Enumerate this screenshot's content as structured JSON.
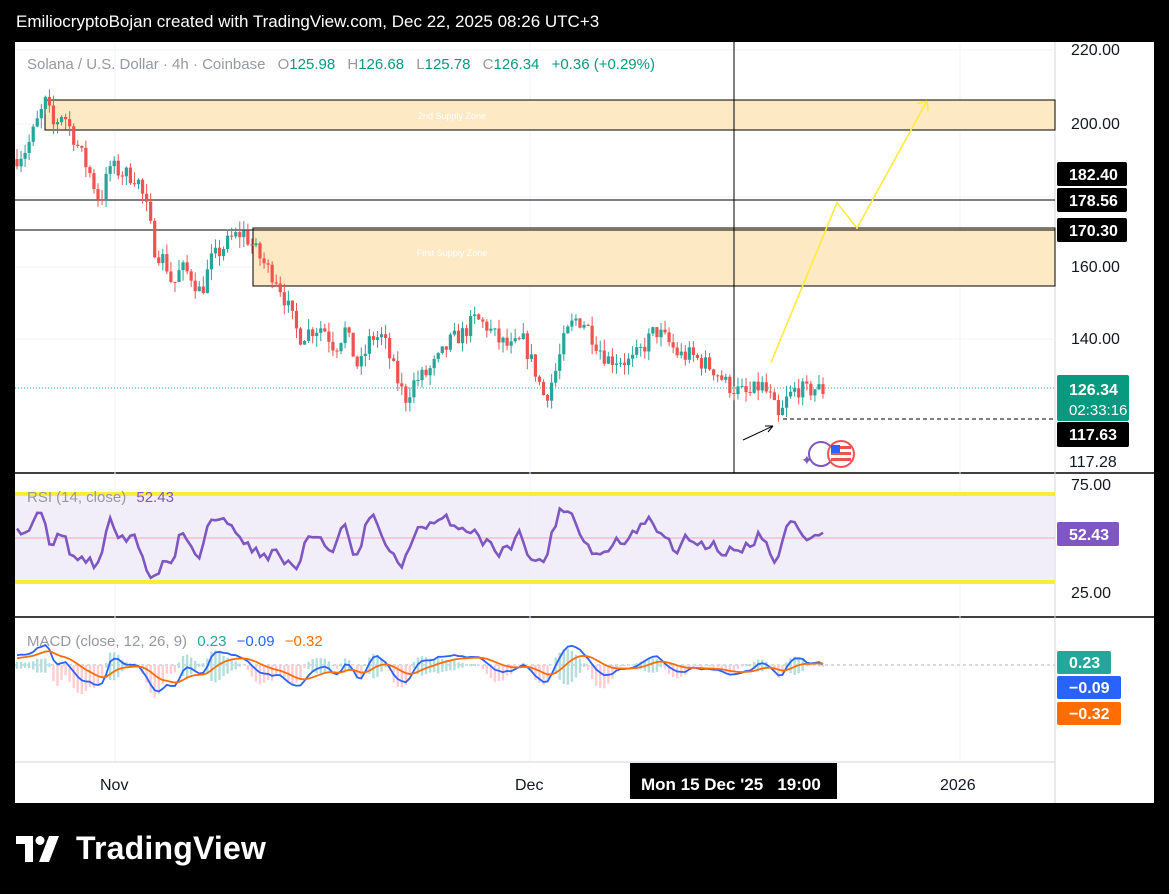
{
  "header": {
    "caption": "EmiliocryptoBojan created with TradingView.com, Dec 22, 2025 08:26 UTC+3"
  },
  "footer": {
    "brand": "TradingView"
  },
  "legend": {
    "symbol": "Solana / U.S. Dollar · 4h · Coinbase",
    "o_label": "O",
    "o_value": "125.98",
    "h_label": "H",
    "h_value": "126.68",
    "l_label": "L",
    "l_value": "125.78",
    "c_label": "C",
    "c_value": "126.34",
    "change": "+0.36 (+0.29%)"
  },
  "zones": {
    "zone2": "2nd Supply Zone",
    "zone1": "First Supply Zone"
  },
  "price_axis": {
    "ticks": [
      "220.00",
      "200.00",
      "160.00",
      "140.00"
    ],
    "labels": {
      "l182": "182.40",
      "l178": "178.56",
      "l170": "170.30",
      "current": "126.34",
      "countdown": "02:33:16",
      "l117a": "117.63",
      "l117b": "117.28"
    }
  },
  "rsi": {
    "title": "RSI (14, close)",
    "value": "52.43",
    "ticks": [
      "75.00",
      "25.00"
    ],
    "badge": "52.43"
  },
  "macd": {
    "title": "MACD (close, 12, 26, 9)",
    "v1": "0.23",
    "v2": "−0.09",
    "v3": "−0.32",
    "badges": [
      "0.23",
      "−0.09",
      "−0.32"
    ]
  },
  "time_axis": {
    "labels": [
      "Nov",
      "Dec",
      "2026"
    ],
    "crosshair": "Mon 15 Dec '25   19:00"
  },
  "colors": {
    "up": "#26a69a",
    "down": "#ef5350",
    "rsi": "#7e57c2",
    "macd": "#2962ff",
    "signal": "#ff6d00",
    "zone": "#fde9c4",
    "projection": "#ffeb3b"
  },
  "chart_data": {
    "type": "candlestick",
    "title": "Solana / U.S. Dollar · 4h · Coinbase",
    "ylim": [
      110,
      222
    ],
    "x": [
      "Nov",
      "Dec",
      "2026"
    ],
    "supply_zones": [
      {
        "name": "2nd Supply Zone",
        "from": 198,
        "to": 206
      },
      {
        "name": "First Supply Zone",
        "from": 154.5,
        "to": 170.5
      }
    ],
    "levels": [
      182.4,
      178.56,
      170.3,
      126.34,
      117.63,
      117.28
    ],
    "close_path": [
      {
        "x": 0,
        "y": 190
      },
      {
        "x": 12,
        "y": 193
      },
      {
        "x": 22,
        "y": 200
      },
      {
        "x": 31,
        "y": 206
      },
      {
        "x": 38,
        "y": 199
      },
      {
        "x": 48,
        "y": 203
      },
      {
        "x": 62,
        "y": 194
      },
      {
        "x": 75,
        "y": 186
      },
      {
        "x": 85,
        "y": 178
      },
      {
        "x": 95,
        "y": 188
      },
      {
        "x": 108,
        "y": 186
      },
      {
        "x": 122,
        "y": 185
      },
      {
        "x": 132,
        "y": 176
      },
      {
        "x": 140,
        "y": 165
      },
      {
        "x": 150,
        "y": 162
      },
      {
        "x": 158,
        "y": 155
      },
      {
        "x": 166,
        "y": 160
      },
      {
        "x": 176,
        "y": 158
      },
      {
        "x": 186,
        "y": 153
      },
      {
        "x": 196,
        "y": 162
      },
      {
        "x": 206,
        "y": 165
      },
      {
        "x": 216,
        "y": 168
      },
      {
        "x": 228,
        "y": 170
      },
      {
        "x": 240,
        "y": 165
      },
      {
        "x": 252,
        "y": 160
      },
      {
        "x": 262,
        "y": 157
      },
      {
        "x": 272,
        "y": 150
      },
      {
        "x": 284,
        "y": 141
      },
      {
        "x": 296,
        "y": 143
      },
      {
        "x": 308,
        "y": 144
      },
      {
        "x": 320,
        "y": 138
      },
      {
        "x": 330,
        "y": 143
      },
      {
        "x": 344,
        "y": 132
      },
      {
        "x": 356,
        "y": 141
      },
      {
        "x": 368,
        "y": 141
      },
      {
        "x": 380,
        "y": 131
      },
      {
        "x": 390,
        "y": 124
      },
      {
        "x": 400,
        "y": 129
      },
      {
        "x": 412,
        "y": 131
      },
      {
        "x": 424,
        "y": 135
      },
      {
        "x": 436,
        "y": 140
      },
      {
        "x": 448,
        "y": 142
      },
      {
        "x": 460,
        "y": 146
      },
      {
        "x": 472,
        "y": 144
      },
      {
        "x": 484,
        "y": 140
      },
      {
        "x": 496,
        "y": 138
      },
      {
        "x": 508,
        "y": 140
      },
      {
        "x": 520,
        "y": 132
      },
      {
        "x": 530,
        "y": 124
      },
      {
        "x": 540,
        "y": 131
      },
      {
        "x": 550,
        "y": 141
      },
      {
        "x": 560,
        "y": 146
      },
      {
        "x": 570,
        "y": 145
      },
      {
        "x": 580,
        "y": 140
      },
      {
        "x": 592,
        "y": 135
      },
      {
        "x": 604,
        "y": 135
      },
      {
        "x": 616,
        "y": 134
      },
      {
        "x": 628,
        "y": 138
      },
      {
        "x": 640,
        "y": 143
      },
      {
        "x": 652,
        "y": 140
      },
      {
        "x": 664,
        "y": 136
      },
      {
        "x": 676,
        "y": 136
      },
      {
        "x": 688,
        "y": 134
      },
      {
        "x": 700,
        "y": 132
      },
      {
        "x": 712,
        "y": 128
      },
      {
        "x": 724,
        "y": 126
      },
      {
        "x": 734,
        "y": 125
      },
      {
        "x": 746,
        "y": 128
      },
      {
        "x": 756,
        "y": 124
      },
      {
        "x": 764,
        "y": 118
      },
      {
        "x": 772,
        "y": 124
      },
      {
        "x": 782,
        "y": 127
      },
      {
        "x": 792,
        "y": 126
      },
      {
        "x": 800,
        "y": 127
      },
      {
        "x": 808,
        "y": 126.34
      }
    ],
    "projection": [
      {
        "x": 756,
        "y": 134
      },
      {
        "x": 822,
        "y": 178
      },
      {
        "x": 842,
        "y": 171
      },
      {
        "x": 912,
        "y": 206
      }
    ],
    "rsi": {
      "value": 52.43,
      "upper": 70,
      "lower": 30,
      "ylim": [
        20,
        80
      ]
    },
    "macd": {
      "macd": 0.23,
      "signal": -0.09,
      "histogram": -0.32
    }
  }
}
